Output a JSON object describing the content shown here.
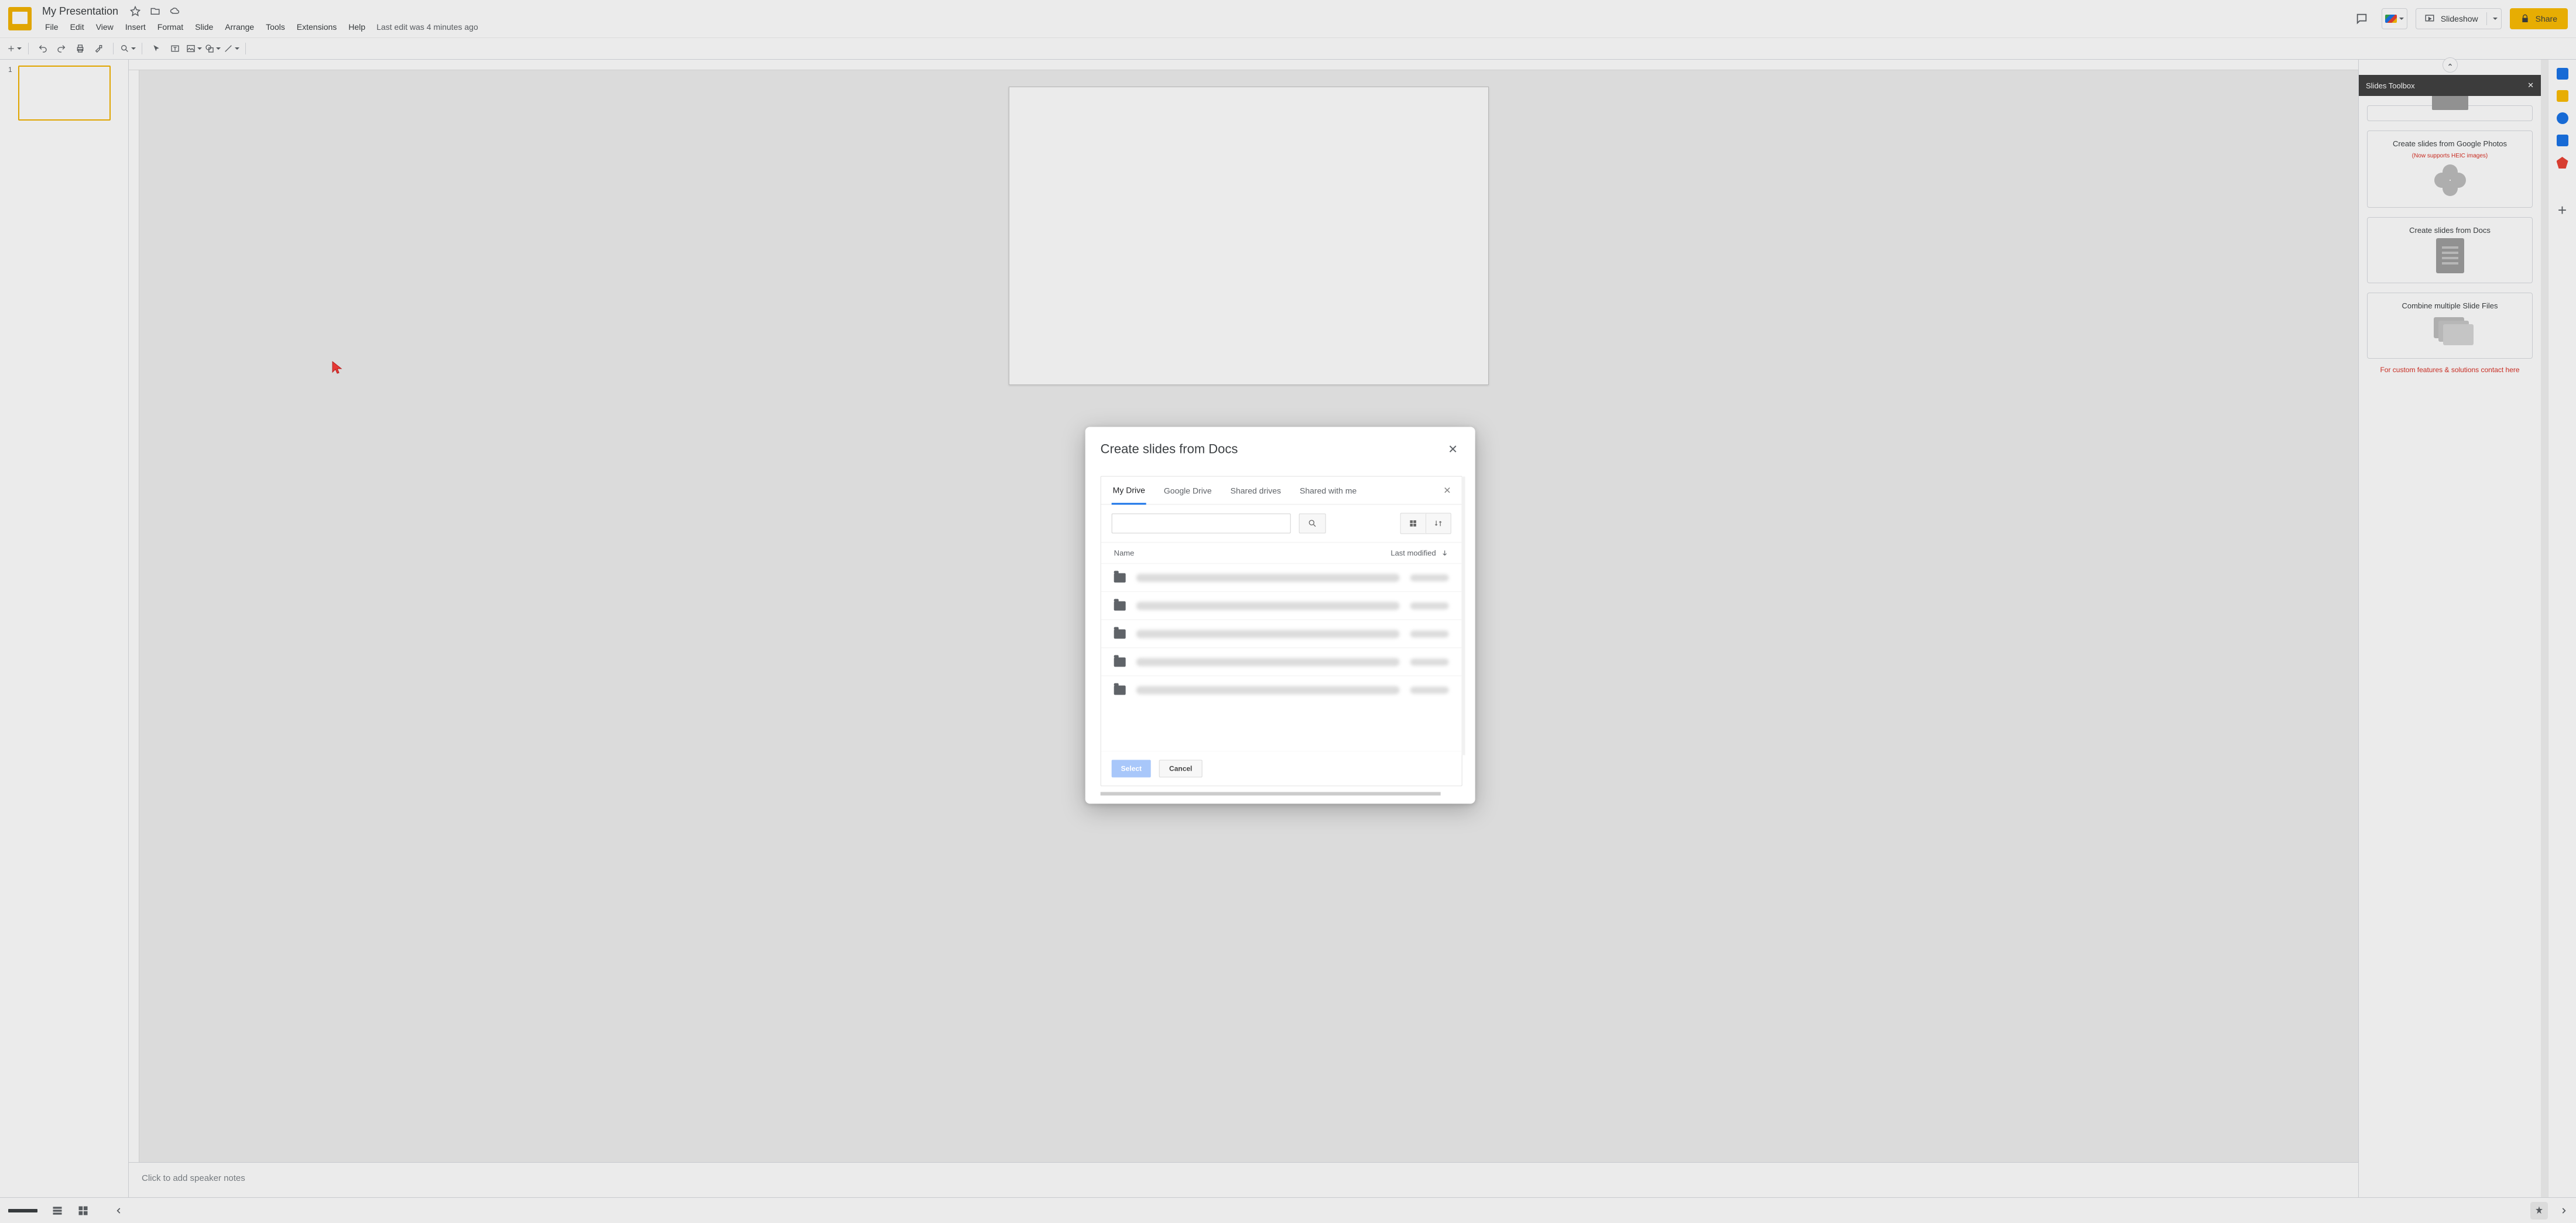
{
  "doc": {
    "title": "My Presentation",
    "lastEdit": "Last edit was 4 minutes ago"
  },
  "menus": {
    "file": "File",
    "edit": "Edit",
    "view": "View",
    "insert": "Insert",
    "format": "Format",
    "slide": "Slide",
    "arrange": "Arrange",
    "tools": "Tools",
    "extensions": "Extensions",
    "help": "Help"
  },
  "titlebar": {
    "slideshow": "Slideshow",
    "share": "Share"
  },
  "thumb": {
    "num": "1"
  },
  "notes": {
    "placeholder": "Click to add speaker notes"
  },
  "sidePanel": {
    "title": "Slides Toolbox",
    "cards": {
      "photos": {
        "title": "Create slides from Google Photos",
        "note": "(Now supports HEIC images)"
      },
      "docs": {
        "title": "Create slides from Docs"
      },
      "combine": {
        "title": "Combine multiple Slide Files"
      }
    },
    "contact": "For custom features & solutions contact here"
  },
  "modal": {
    "title": "Create slides from Docs",
    "tabs": {
      "myDrive": "My Drive",
      "googleDrive": "Google Drive",
      "sharedDrives": "Shared drives",
      "sharedWithMe": "Shared with me"
    },
    "columns": {
      "name": "Name",
      "lastModified": "Last modified"
    },
    "buttons": {
      "select": "Select",
      "cancel": "Cancel"
    }
  }
}
